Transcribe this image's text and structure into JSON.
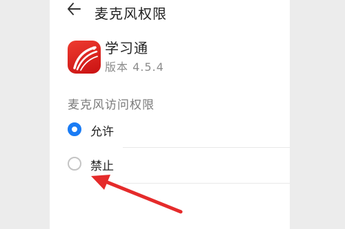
{
  "header": {
    "title": "麦克风权限",
    "back_icon": "arrow-left-icon"
  },
  "app": {
    "icon": "xuexitong-logo-icon",
    "icon_color": "#e8302b",
    "name": "学习通",
    "version": "版本 4.5.4"
  },
  "permission": {
    "section_title": "麦克风访问权限",
    "options": [
      {
        "label": "允许",
        "selected": true
      },
      {
        "label": "禁止",
        "selected": false
      }
    ],
    "accent_color": "#1a7cf5"
  },
  "annotation": {
    "type": "red-arrow",
    "color": "#e52b2b",
    "points_to": "禁止"
  }
}
